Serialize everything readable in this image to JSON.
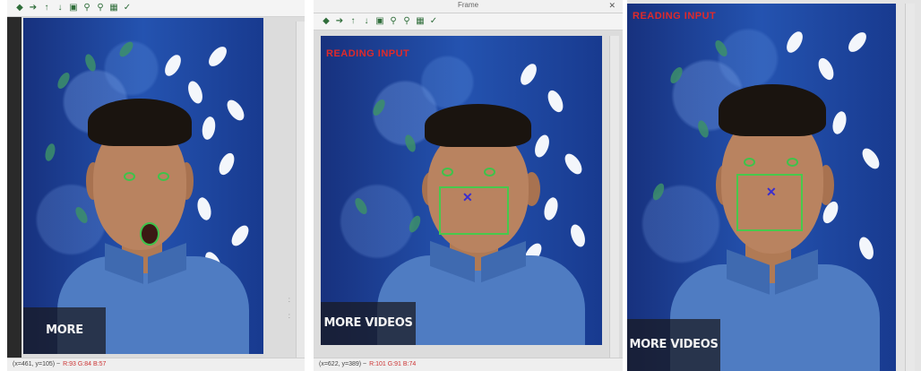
{
  "panels": [
    {
      "id": "p1",
      "window_title": "",
      "status_text": "(x=461, y=105) ~",
      "status_red": "R:93 G:84 B:57",
      "mode_text": "",
      "more_videos": "MORE VIDEOS",
      "fps": "",
      "expression": "mouth-open"
    },
    {
      "id": "p2",
      "window_title": "Frame",
      "status_text": "(x=622, y=389) ~",
      "status_red": "R:101 G:91 B:74",
      "mode_text": "READING INPUT",
      "more_videos": "MORE VIDEOS",
      "fps": "",
      "expression": "squint"
    },
    {
      "id": "p3",
      "window_title": "",
      "status_text": "",
      "status_red": "",
      "mode_text": "READING INPUT",
      "more_videos": "MORE VIDEOS",
      "fps": "",
      "expression": "squint"
    }
  ],
  "toolbar_icons": [
    "pan-left-icon",
    "pan-right-icon",
    "pan-up-icon",
    "pan-down-icon",
    "save-icon",
    "zoom-in-icon",
    "zoom-out-icon",
    "zoom-fit-icon",
    "properties-icon"
  ],
  "colors": {
    "detection_green": "#48c84c",
    "mode_red": "#e02a2a",
    "nose_blue": "#3a2ecf"
  }
}
